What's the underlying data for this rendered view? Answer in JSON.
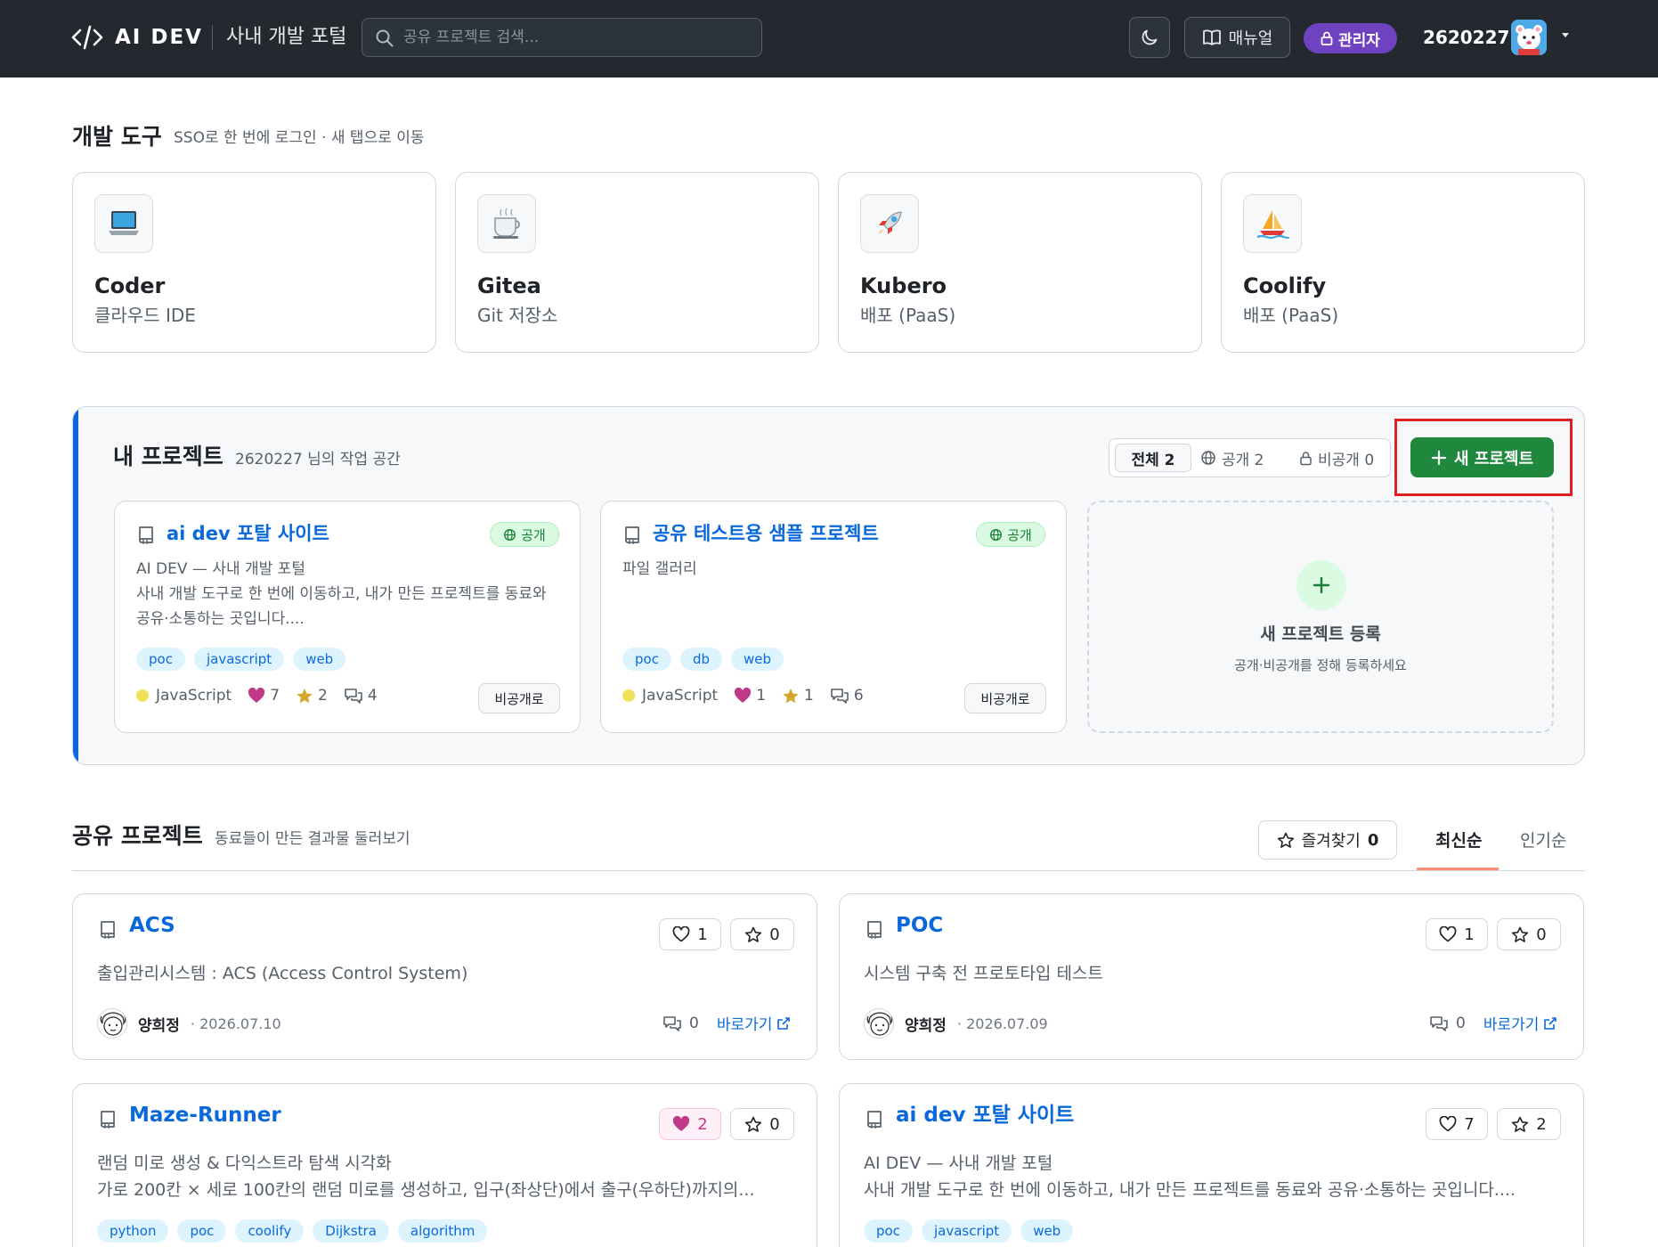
{
  "header": {
    "logo_text": "AI DEV",
    "portal_title": "사내 개발 포털",
    "search_placeholder": "공유 프로젝트 검색...",
    "manual_label": "매뉴얼",
    "admin_label": "관리자",
    "username": "2620227"
  },
  "dev_tools": {
    "title": "개발 도구",
    "subtitle": "SSO로 한 번에 로그인 · 새 탭으로 이동",
    "items": [
      {
        "name": "Coder",
        "desc": "클라우드 IDE",
        "icon": "laptop-icon"
      },
      {
        "name": "Gitea",
        "desc": "Git 저장소",
        "icon": "tea-cup-icon"
      },
      {
        "name": "Kubero",
        "desc": "배포 (PaaS)",
        "icon": "rocket-icon"
      },
      {
        "name": "Coolify",
        "desc": "배포 (PaaS)",
        "icon": "sailboat-icon"
      }
    ]
  },
  "my_projects": {
    "title": "내 프로젝트",
    "subtitle": "2620227 님의 작업 공간",
    "filters": {
      "all": "전체 2",
      "public": "공개 2",
      "private": "비공개 0"
    },
    "new_button": "새 프로젝트",
    "projects": [
      {
        "title": "ai dev 포탈 사이트",
        "badge": "공개",
        "desc_line1": "AI DEV — 사내 개발 포털",
        "desc_line2": "사내 개발 도구로 한 번에 이동하고, 내가 만든 프로젝트를 동료와 공유·소통하는 곳입니다....",
        "tags": [
          "poc",
          "javascript",
          "web"
        ],
        "language": "JavaScript",
        "likes": "7",
        "stars": "2",
        "comments": "4",
        "action": "비공개로"
      },
      {
        "title": "공유 테스트용 샘플 프로젝트",
        "badge": "공개",
        "desc_line1": "파일 갤러리",
        "desc_line2": "",
        "tags": [
          "poc",
          "db",
          "web"
        ],
        "language": "JavaScript",
        "likes": "1",
        "stars": "1",
        "comments": "6",
        "action": "비공개로"
      }
    ],
    "add_card": {
      "title": "새 프로젝트 등록",
      "subtitle": "공개·비공개를 정해 등록하세요"
    }
  },
  "shared_projects": {
    "title": "공유 프로젝트",
    "subtitle": "동료들이 만든 결과물 둘러보기",
    "favorites_label": "즐겨찾기",
    "favorites_count": "0",
    "sort_latest": "최신순",
    "sort_popular": "인기순",
    "go_label": "바로가기",
    "items": [
      {
        "title": "ACS",
        "desc": "출입관리시스템 : ACS (Access Control System)",
        "author": "양희정",
        "date": "· 2026.07.10",
        "likes": "1",
        "stars": "0",
        "comments": "0"
      },
      {
        "title": "POC",
        "desc": "시스템 구축 전 프로토타입 테스트",
        "author": "양희정",
        "date": "· 2026.07.09",
        "likes": "1",
        "stars": "0",
        "comments": "0"
      },
      {
        "title": "Maze-Runner",
        "desc_line1": "랜덤 미로 생성 & 다익스트라 탐색 시각화",
        "desc_line2": "가로 200칸 × 세로 100칸의 랜덤 미로를 생성하고, 입구(좌상단)에서 출구(우하단)까지의...",
        "tags": [
          "python",
          "poc",
          "coolify",
          "Dijkstra",
          "algorithm"
        ],
        "likes": "2",
        "stars": "0"
      },
      {
        "title": "ai dev 포탈 사이트",
        "desc_line1": "AI DEV — 사내 개발 포털",
        "desc_line2": "사내 개발 도구로 한 번에 이동하고, 내가 만든 프로젝트를 동료와 공유·소통하는 곳입니다....",
        "tags": [
          "poc",
          "javascript",
          "web"
        ],
        "likes": "7",
        "stars": "2"
      }
    ]
  },
  "colors": {
    "header_bg": "#24292f",
    "accent": "#0969da",
    "primary_green": "#1f883d",
    "admin_purple": "#6f42c1",
    "highlight_red": "#e02020"
  }
}
